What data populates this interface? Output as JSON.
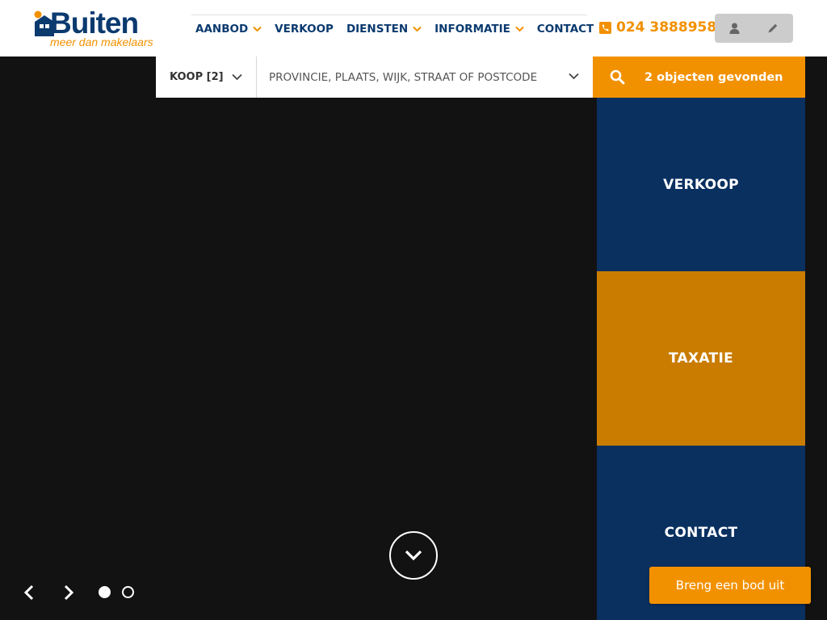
{
  "brand": {
    "name": "Buiten",
    "tagline": "meer dan makelaars",
    "primary_color": "#0b3a6f",
    "accent_color": "#f29100"
  },
  "nav": {
    "items": [
      {
        "label": "AANBOD",
        "has_dropdown": true
      },
      {
        "label": "VERKOOP",
        "has_dropdown": false
      },
      {
        "label": "DIENSTEN",
        "has_dropdown": true
      },
      {
        "label": "INFORMATIE",
        "has_dropdown": true
      },
      {
        "label": "CONTACT",
        "has_dropdown": true
      }
    ]
  },
  "header": {
    "phone": "024 3888958",
    "phone_icon": "phone-icon",
    "account_icon": "user-icon",
    "edit_icon": "pencil-icon"
  },
  "search": {
    "type_label": "KOOP [2]",
    "location_placeholder": "PROVINCIE, PLAATS, WIJK, STRAAT OF POSTCODE",
    "results_label": "2 objecten gevonden"
  },
  "tiles": {
    "verkoop": "VERKOOP",
    "taxatie": "TAXATIE",
    "contact": "CONTACT"
  },
  "slider": {
    "total_slides": 2,
    "active_slide": 1
  },
  "cta": {
    "bid_label": "Breng een bod uit"
  }
}
